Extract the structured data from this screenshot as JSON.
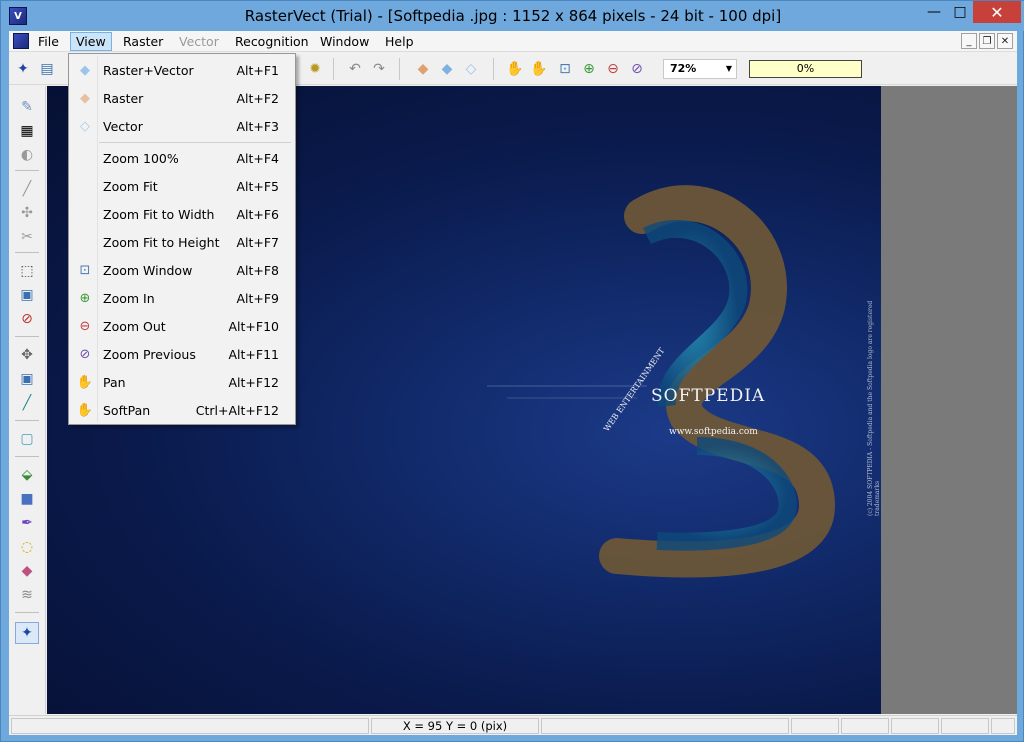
{
  "window": {
    "title": "RasterVect (Trial) - [Softpedia .jpg : 1152 x 864 pixels - 24 bit - 100 dpi]",
    "app_icon_letter": "V",
    "minimize": "—",
    "maximize": "□",
    "close": "✕"
  },
  "menubar": {
    "items": [
      {
        "label": "File"
      },
      {
        "label": "View"
      },
      {
        "label": "Raster"
      },
      {
        "label": "Vector"
      },
      {
        "label": "Recognition"
      },
      {
        "label": "Window"
      },
      {
        "label": "Help"
      }
    ],
    "mdi_min": "_",
    "mdi_restore": "❐",
    "mdi_close": "✕"
  },
  "toolbar": {
    "zoom_value": "72%",
    "progress_text": "0%"
  },
  "view_menu": {
    "items": [
      {
        "label": "Raster+Vector",
        "accel": "Alt+F1",
        "icon": "raster-vector-icon"
      },
      {
        "label": "Raster",
        "accel": "Alt+F2",
        "icon": "raster-icon"
      },
      {
        "label": "Vector",
        "accel": "Alt+F3",
        "icon": "vector-icon"
      },
      {
        "label": "Zoom 100%",
        "accel": "Alt+F4"
      },
      {
        "label": "Zoom Fit",
        "accel": "Alt+F5"
      },
      {
        "label": "Zoom Fit to Width",
        "accel": "Alt+F6"
      },
      {
        "label": "Zoom Fit to Height",
        "accel": "Alt+F7"
      },
      {
        "label": "Zoom Window",
        "accel": "Alt+F8",
        "icon": "zoom-window-icon"
      },
      {
        "label": "Zoom In",
        "accel": "Alt+F9",
        "icon": "zoom-in-icon"
      },
      {
        "label": "Zoom Out",
        "accel": "Alt+F10",
        "icon": "zoom-out-icon"
      },
      {
        "label": "Zoom Previous",
        "accel": "Alt+F11",
        "icon": "zoom-previous-icon"
      },
      {
        "label": "Pan",
        "accel": "Alt+F12",
        "icon": "pan-hand-icon"
      },
      {
        "label": "SoftPan",
        "accel": "Ctrl+Alt+F12",
        "icon": "softpan-hand-icon"
      }
    ]
  },
  "image": {
    "brand": "SOFTPEDIA",
    "url": "www.softpedia.com",
    "arc_text": "WEB ENTERTAINMENT",
    "side_text": "(c) 2004 SOFTPEDIA - Softpedia and the Softpedia logo are registered trademarks"
  },
  "statusbar": {
    "coords": "X = 95   Y = 0 (pix)"
  }
}
